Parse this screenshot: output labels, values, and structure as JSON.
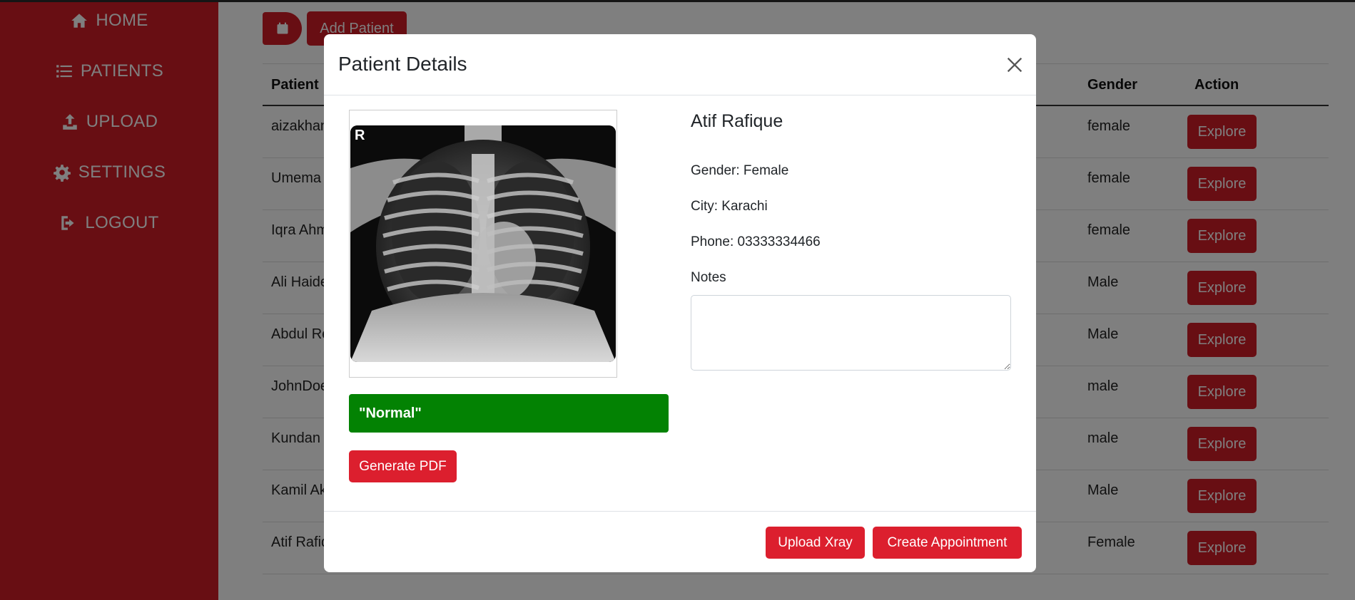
{
  "sidebar": {
    "items": [
      {
        "label": "HOME",
        "icon": "home-icon"
      },
      {
        "label": "PATIENTS",
        "icon": "list-icon"
      },
      {
        "label": "UPLOAD",
        "icon": "upload-icon"
      },
      {
        "label": "SETTINGS",
        "icon": "gear-icon"
      },
      {
        "label": "LOGOUT",
        "icon": "logout-icon"
      }
    ]
  },
  "toolbar": {
    "calendar_icon": "calendar-icon",
    "add_patient_label": "Add Patient"
  },
  "table": {
    "headers": {
      "patient": "Patient",
      "gender": "Gender",
      "action": "Action"
    },
    "rows": [
      {
        "patient": "aizakhan",
        "gender": "female",
        "action": "Explore"
      },
      {
        "patient": "Umema",
        "gender": "female",
        "action": "Explore"
      },
      {
        "patient": "Iqra Ahm",
        "gender": "female",
        "action": "Explore"
      },
      {
        "patient": "Ali Haide",
        "gender": "Male",
        "action": "Explore"
      },
      {
        "patient": "Abdul Re",
        "gender": "Male",
        "action": "Explore"
      },
      {
        "patient": "JohnDoe",
        "gender": "male",
        "action": "Explore"
      },
      {
        "patient": "Kundan",
        "gender": "male",
        "action": "Explore"
      },
      {
        "patient": "Kamil Ak",
        "gender": "Male",
        "action": "Explore"
      },
      {
        "patient": "Atif Rafiq",
        "gender": "Female",
        "action": "Explore"
      }
    ]
  },
  "modal": {
    "title": "Patient Details",
    "xray_marker": "R",
    "result_label": "\"Normal\"",
    "generate_pdf_label": "Generate PDF",
    "patient_name": "Atif Rafique",
    "gender_line": "Gender: Female",
    "city_line": "City: Karachi",
    "phone_line": "Phone: 03333334466",
    "notes_label": "Notes",
    "notes_value": "",
    "upload_xray_label": "Upload Xray",
    "create_appointment_label": "Create Appointment"
  },
  "colors": {
    "brand_red": "#d11c26",
    "result_green": "#038203"
  }
}
